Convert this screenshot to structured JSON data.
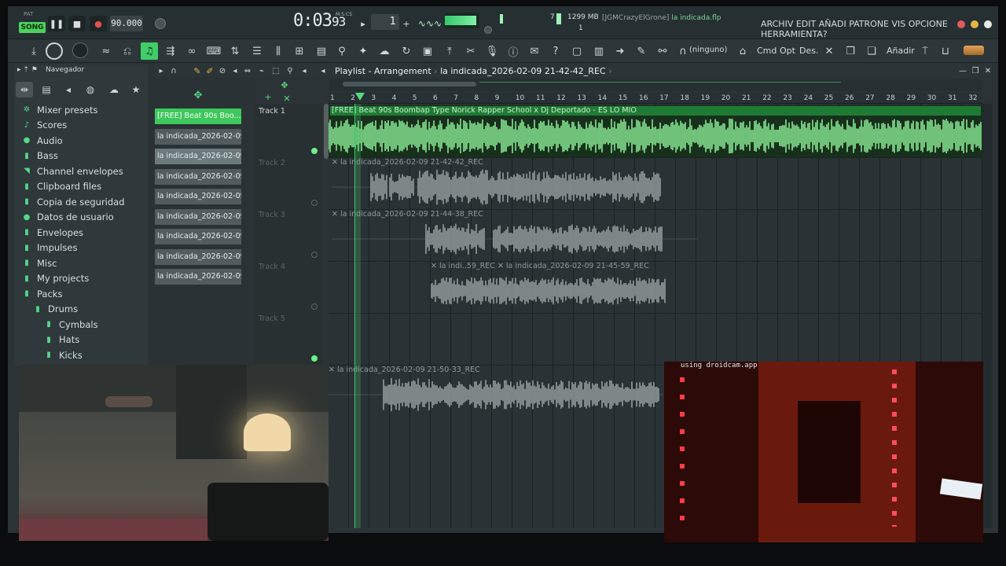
{
  "transport": {
    "song_tag": "PAT",
    "song_label": "SONG",
    "tempo": "90.000",
    "time_main": "0:03",
    "time_ms": "93",
    "time_sub": "M:S:CS",
    "pattern": "1",
    "cpu_num": "7",
    "mem": "1299 MB",
    "poly": "1",
    "hint_user": "[JGMCrazyElGrone]",
    "hint_file": "la indicada.flp",
    "menu": "ARCHIV EDIT AÑADI PATRONE VIS OPCIONE HERRAMIENTA?"
  },
  "toolbar": {
    "ninguno": "(ninguno)",
    "cmd": "Cmd",
    "opt": "Opt",
    "des": "Des.",
    "anadir": "Añadir"
  },
  "browser": {
    "title": "Navegador",
    "items": [
      {
        "icon": "gear-icon",
        "glyph": "✲",
        "label": "Mixer presets"
      },
      {
        "icon": "note-icon",
        "glyph": "♪",
        "label": "Scores"
      },
      {
        "icon": "user-icon",
        "glyph": "●",
        "label": "Audio"
      },
      {
        "icon": "folder-icon",
        "glyph": "▮",
        "label": "Bass"
      },
      {
        "icon": "envelope-icon",
        "glyph": "◥",
        "label": "Channel envelopes"
      },
      {
        "icon": "folder-icon",
        "glyph": "▮",
        "label": "Clipboard files"
      },
      {
        "icon": "folder-icon",
        "glyph": "▮",
        "label": "Copia de seguridad"
      },
      {
        "icon": "user-icon",
        "glyph": "●",
        "label": "Datos de usuario"
      },
      {
        "icon": "folder-icon",
        "glyph": "▮",
        "label": "Envelopes"
      },
      {
        "icon": "folder-icon",
        "glyph": "▮",
        "label": "Impulses"
      },
      {
        "icon": "folder-icon",
        "glyph": "▮",
        "label": "Misc"
      },
      {
        "icon": "folder-icon",
        "glyph": "▮",
        "label": "My projects"
      },
      {
        "icon": "folder-icon",
        "glyph": "▮",
        "label": "Packs"
      },
      {
        "icon": "folder-icon",
        "glyph": "▮",
        "label": "Drums",
        "indent": 1
      },
      {
        "icon": "folder-icon",
        "glyph": "▮",
        "label": "Cymbals",
        "indent": 2
      },
      {
        "icon": "folder-icon",
        "glyph": "▮",
        "label": "Hats",
        "indent": 2
      },
      {
        "icon": "folder-icon",
        "glyph": "▮",
        "label": "Kicks",
        "indent": 2
      }
    ]
  },
  "clips": [
    "[FREE] Beat 90s Boo...",
    "la indicada_2026-02-09...",
    "la indicada_2026-02-09...",
    "la indicada_2026-02-09...",
    "la indicada_2026-02-09...",
    "la indicada_2026-02-09...",
    "la indicada_2026-02-09...",
    "la indicada_2026-02-09...",
    "la indicada_2026-02-09..."
  ],
  "playlist": {
    "title": "Playlist - Arrangement",
    "pattern": "la indicada_2026-02-09 21-42-42_REC",
    "ruler": [
      "1",
      "2",
      "3",
      "4",
      "5",
      "6",
      "7",
      "8",
      "9",
      "10",
      "11",
      "12",
      "13",
      "14",
      "15",
      "16",
      "17",
      "18",
      "19",
      "20",
      "21",
      "22",
      "23",
      "24",
      "25",
      "26",
      "27",
      "28",
      "29",
      "30",
      "31",
      "32"
    ],
    "tracks": [
      "Track 1",
      "Track 2",
      "Track 3",
      "Track 4",
      "Track 5"
    ],
    "clip_track1": "[FREE] Beat 90s Boombap Type Norick Rapper School x Dj Deportado - ES LO MIO",
    "clip_track2": "la indicada_2026-02-09 21-42-42_REC",
    "clip_track3": "la indicada_2026-02-09 21-44-38_REC",
    "clip_track4a": "la indi..59_REC",
    "clip_track4b": "la indicada_2026-02-09 21-45-59_REC",
    "clip_track6": "la indicada_2026-02-09 21-50-33_REC"
  },
  "overlay": {
    "cam_caption": "using droidcam.app"
  },
  "colors": {
    "accent_green": "#3fce68",
    "waveform_green": "#8ff29a",
    "waveform_gray": "#9aa2a5"
  }
}
